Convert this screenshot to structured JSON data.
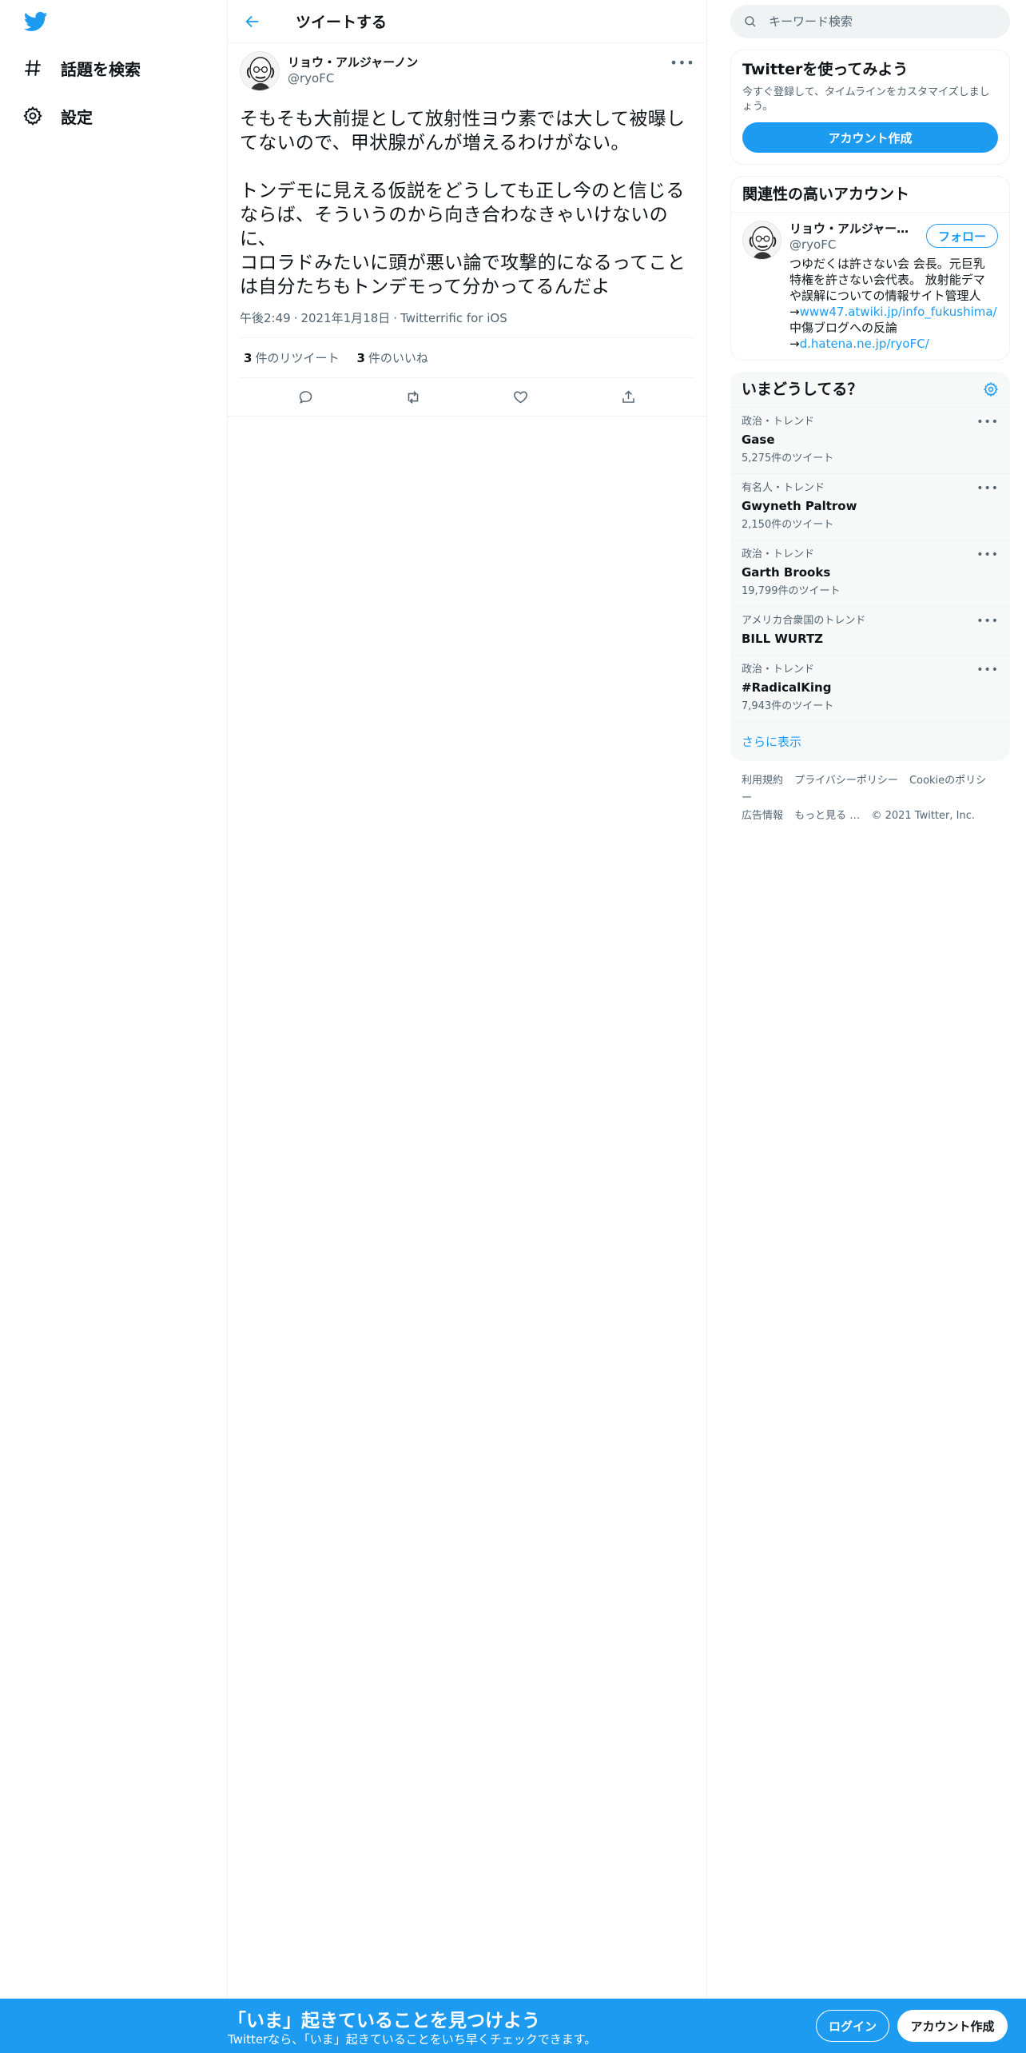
{
  "brand": {
    "accent": "#1d9bf0",
    "logo_icon": "twitter-bird-icon"
  },
  "nav": {
    "items": [
      {
        "label": "話題を検索",
        "icon": "hashtag-icon"
      },
      {
        "label": "設定",
        "icon": "gear-icon"
      }
    ]
  },
  "header": {
    "title": "ツイートする"
  },
  "tweet": {
    "author_name": "リョウ・アルジャーノン",
    "author_handle": "@ryoFC",
    "text": "そもそも大前提として放射性ヨウ素では大して被曝してないので、甲状腺がんが増えるわけがない。\n\nトンデモに見える仮説をどうしても正し今のと信じるならば、そういうのから向き合わなきゃいけないのに、\nコロラドみたいに頭が悪い論で攻撃的になるってことは自分たちもトンデモって分かってるんだよ",
    "time": "午後2:49",
    "date": "2021年1月18日",
    "source": "Twitterrific for iOS",
    "retweets": "3",
    "retweets_label": "件のリツイート",
    "likes": "3",
    "likes_label": "件のいいね"
  },
  "search": {
    "placeholder": "キーワード検索"
  },
  "signup_card": {
    "title": "Twitterを使ってみよう",
    "subtitle": "今すぐ登録して、タイムラインをカスタマイズしましょう。",
    "button": "アカウント作成"
  },
  "related": {
    "title": "関連性の高いアカウント",
    "name": "リョウ・アルジャー…",
    "handle": "@ryoFC",
    "follow": "フォロー",
    "bio_text": "つゆだくは許さない会 会長。元巨乳特権を許さない会代表。 放射能デマや誤解についての情報サイト管理人→",
    "bio_link1": "www47.atwiki.jp/info_fukushima/",
    "bio_mid": " 中傷ブログへの反論→",
    "bio_link2": "d.hatena.ne.jp/ryoFC/"
  },
  "trends": {
    "title": "いまどうしてる？",
    "items": [
      {
        "context": "政治・トレンド",
        "name": "Gase",
        "count": "5,275件のツイート"
      },
      {
        "context": "有名人・トレンド",
        "name": "Gwyneth Paltrow",
        "count": "2,150件のツイート"
      },
      {
        "context": "政治・トレンド",
        "name": "Garth Brooks",
        "count": "19,799件のツイート"
      },
      {
        "context": "アメリカ合衆国のトレンド",
        "name": "BILL WURTZ",
        "count": ""
      },
      {
        "context": "政治・トレンド",
        "name": "#RadicalKing",
        "count": "7,943件のツイート"
      }
    ],
    "show_more": "さらに表示"
  },
  "footer": {
    "links": [
      "利用規約",
      "プライバシーポリシー",
      "Cookieのポリシー",
      "広告情報",
      "もっと見る …",
      "© 2021 Twitter, Inc."
    ]
  },
  "bottom_bar": {
    "title": "「いま」起きていることを見つけよう",
    "subtitle": "Twitterなら、「いま」起きていることをいち早くチェックできます。",
    "login": "ログイン",
    "signup": "アカウント作成"
  }
}
